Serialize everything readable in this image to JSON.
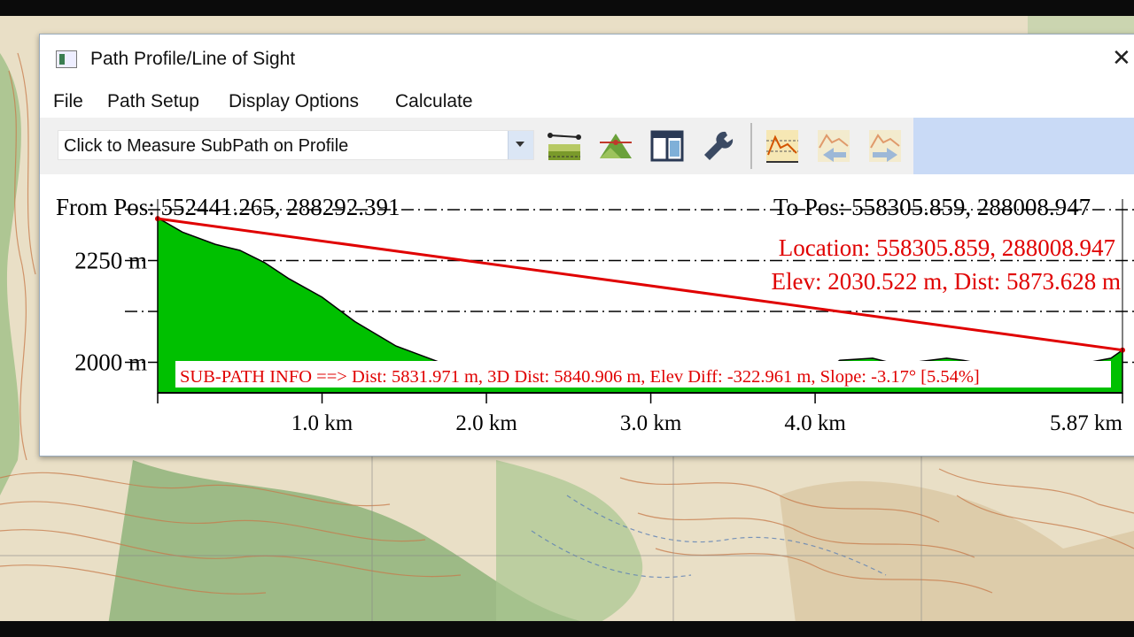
{
  "window": {
    "title": "Path Profile/Line of Sight",
    "close_glyph": "✕"
  },
  "menu": {
    "items": [
      "File",
      "Path Setup",
      "Display Options",
      "Calculate"
    ]
  },
  "toolbar": {
    "combo_value": "Click to Measure SubPath on Profile",
    "icons": [
      "path-profile-icon",
      "terrain-peak-icon",
      "split-panel-icon",
      "wrench-icon",
      "los-chart-icon",
      "back-arrow-chart-icon",
      "forward-arrow-chart-icon"
    ]
  },
  "profile": {
    "from_pos": "From Pos: 552441.265, 288292.391",
    "to_pos": "To Pos: 558305.859, 288008.947",
    "location": "Location: 558305.859, 288008.947",
    "elev_dist": "Elev: 2030.522 m, Dist: 5873.628 m",
    "subpath_info": "SUB-PATH INFO ==> Dist: 5831.971 m, 3D Dist: 5840.906 m, Elev Diff: -322.961 m, Slope: -3.17° [5.54%]"
  },
  "colors": {
    "terrain_fill": "#00c000",
    "los_line": "#e00000",
    "annotation_text": "#e00000"
  },
  "chart_data": {
    "type": "area",
    "x_unit": "km",
    "y_unit": "m",
    "xlim": [
      0,
      5.87
    ],
    "ylim": [
      1925,
      2375
    ],
    "y_ticks": [
      2000,
      2250
    ],
    "y_tick_labels": [
      "2000 m",
      "2250 m"
    ],
    "x_ticks": [
      1.0,
      2.0,
      3.0,
      4.0,
      5.87
    ],
    "x_tick_labels": [
      "1.0 km",
      "2.0 km",
      "3.0 km",
      "4.0 km",
      "5.87 km"
    ],
    "dashed_levels": [
      2375,
      2250,
      2125,
      2000
    ],
    "terrain": {
      "x": [
        0,
        0.15,
        0.35,
        0.5,
        0.65,
        0.8,
        1.0,
        1.2,
        1.45,
        1.65,
        1.75,
        1.85,
        2.4,
        2.6,
        3.8,
        4.1,
        4.15,
        4.35,
        4.5,
        4.6,
        4.8,
        4.9,
        5.1,
        5.2,
        5.5,
        5.6,
        5.8,
        5.87
      ],
      "y": [
        2355,
        2320,
        2290,
        2275,
        2245,
        2205,
        2160,
        2100,
        2040,
        2010,
        1995,
        1990,
        1990,
        1990,
        1985,
        1990,
        2005,
        2010,
        1995,
        2000,
        2010,
        2005,
        1990,
        1990,
        1990,
        1995,
        2010,
        2030
      ]
    },
    "line_of_sight": {
      "x": [
        0,
        5.87
      ],
      "y": [
        2353,
        2030
      ]
    }
  }
}
